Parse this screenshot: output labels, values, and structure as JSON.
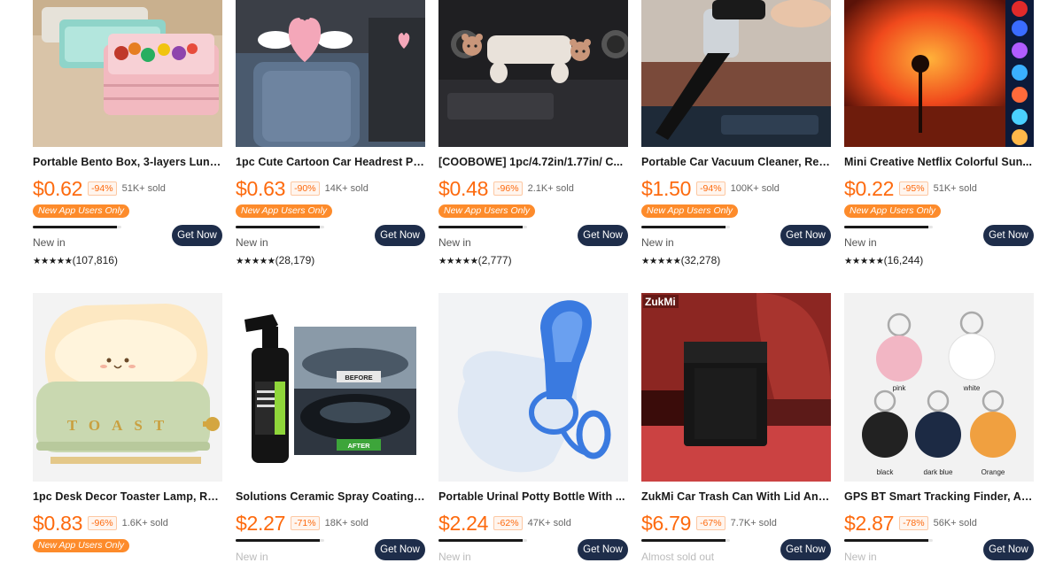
{
  "products": [
    {
      "title": "Portable Bento Box, 3-layers Lunc...",
      "price": "$0.62",
      "discount": "-94%",
      "sold": "51K+ sold",
      "tag": "New App Users Only",
      "status": "New in",
      "button": "Get Now",
      "stars": "★★★★★",
      "rating_count": "(107,816)",
      "progress": 0.95
    },
    {
      "title": "1pc Cute Cartoon Car Headrest Pil...",
      "price": "$0.63",
      "discount": "-90%",
      "sold": "14K+ sold",
      "tag": "New App Users Only",
      "status": "New in",
      "button": "Get Now",
      "stars": "★★★★★",
      "rating_count": "(28,179)",
      "progress": 0.95
    },
    {
      "title": "[COOBOWE] 1pc/4.72in/1.77in/ C...",
      "price": "$0.48",
      "discount": "-96%",
      "sold": "2.1K+ sold",
      "tag": "New App Users Only",
      "status": "New in",
      "button": "Get Now",
      "stars": "★★★★★",
      "rating_count": "(2,777)",
      "progress": 0.95
    },
    {
      "title": "Portable Car Vacuum Cleaner, Rec...",
      "price": "$1.50",
      "discount": "-94%",
      "sold": "100K+ sold",
      "tag": "New App Users Only",
      "status": "New in",
      "button": "Get Now",
      "stars": "★★★★★",
      "rating_count": "(32,278)",
      "progress": 0.95
    },
    {
      "title": "Mini Creative Netflix Colorful Sun...",
      "price": "$0.22",
      "discount": "-95%",
      "sold": "51K+ sold",
      "tag": "New App Users Only",
      "status": "New in",
      "button": "Get Now",
      "stars": "★★★★★",
      "rating_count": "(16,244)",
      "progress": 0.95
    },
    {
      "title": "1pc Desk Decor Toaster Lamp, Rec...",
      "price": "$0.83",
      "discount": "-96%",
      "sold": "1.6K+ sold",
      "tag": "New App Users Only"
    },
    {
      "title": "Solutions Ceramic Spray Coating, ...",
      "price": "$2.27",
      "discount": "-71%",
      "sold": "18K+ sold",
      "status": "New in",
      "button": "Get Now",
      "progress": 0.95
    },
    {
      "title": "Portable Urinal Potty Bottle With ...",
      "price": "$2.24",
      "discount": "-62%",
      "sold": "47K+ sold",
      "status": "New in",
      "button": "Get Now",
      "progress": 0.95
    },
    {
      "title": "ZukMi Car Trash Can With Lid And...",
      "price": "$6.79",
      "discount": "-67%",
      "sold": "7.7K+ sold",
      "status": "Almost sold out",
      "button": "Get Now",
      "progress": 0.95
    },
    {
      "title": "GPS BT Smart Tracking Finder, Ant...",
      "price": "$2.87",
      "discount": "-78%",
      "sold": "56K+ sold",
      "status": "New in",
      "button": "Get Now",
      "progress": 0.95
    }
  ],
  "image_labels": {
    "toast_word": "TOAST",
    "before": "BEFORE",
    "after": "AFTER",
    "brand_logo": "ZukMi",
    "tracker_colors": [
      "pink",
      "white",
      "black",
      "dark blue",
      "Orange"
    ]
  },
  "colors": {
    "price": "#fd6a0e",
    "button": "#1e2d4a",
    "tag": "#fd8b2b"
  }
}
